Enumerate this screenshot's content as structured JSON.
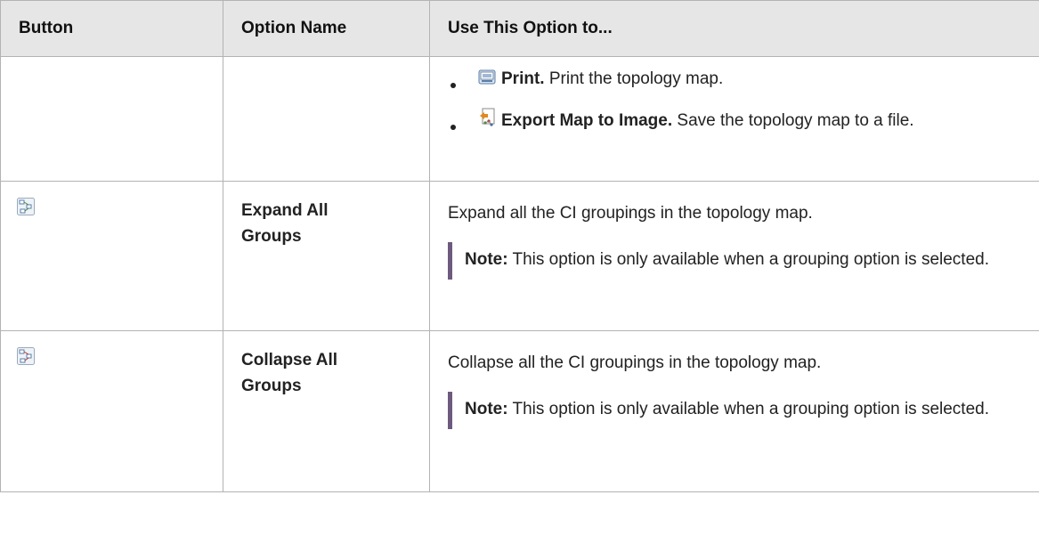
{
  "table": {
    "headers": [
      "Button",
      "Option Name",
      "Use This Option to..."
    ],
    "rows": [
      {
        "option_name": "",
        "bullets": [
          {
            "icon": "print-icon",
            "bold": "Print.",
            "text": " Print the topology map."
          },
          {
            "icon": "export-map-image-icon",
            "bold": "Export Map to Image.",
            "text": " Save the topology map to a file."
          }
        ]
      },
      {
        "icon": "expand-all-groups-icon",
        "option_name": "Expand All Groups",
        "description": "Expand all the CI groupings in the topology map.",
        "note_label": "Note:",
        "note_text": "  This option is only available when a grouping option is selected."
      },
      {
        "icon": "collapse-all-groups-icon",
        "option_name": "Collapse All Groups",
        "description": "Collapse all the CI groupings in the topology map.",
        "note_label": "Note:",
        "note_text": "  This option is only available when a grouping option is selected."
      }
    ]
  },
  "colors": {
    "header_bg": "#e6e6e6",
    "border": "#b3b3b3",
    "note_bar": "#6e5a7e"
  }
}
